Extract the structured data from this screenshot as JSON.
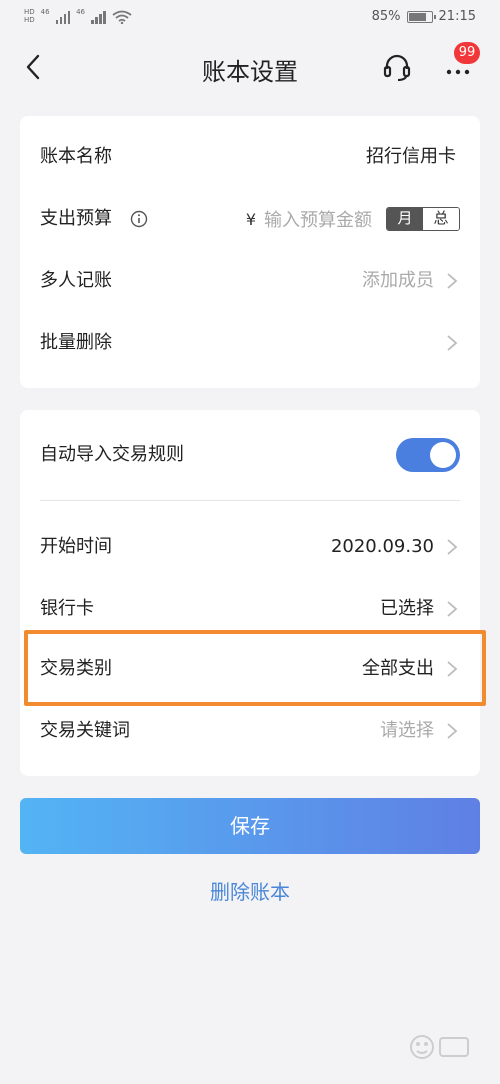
{
  "status_bar": {
    "signal1_label": "46",
    "signal2_label": "46",
    "battery_percent": "85%",
    "battery_level": 0.85,
    "time": "21:15"
  },
  "header": {
    "title": "账本设置",
    "badge_count": "99",
    "icons": [
      "back-icon",
      "headset-icon",
      "more-icon"
    ]
  },
  "settings_card": {
    "ledger_name": {
      "label": "账本名称",
      "value": "招行信用卡"
    },
    "budget": {
      "label": "支出预算",
      "currency": "¥",
      "placeholder": "输入预算金额",
      "segments": [
        "月",
        "总"
      ],
      "selected": "月"
    },
    "members": {
      "label": "多人记账",
      "value": "添加成员"
    },
    "batch_delete": {
      "label": "批量删除"
    }
  },
  "import_card": {
    "auto_import": {
      "label": "自动导入交易规则",
      "enabled": true
    },
    "start_time": {
      "label": "开始时间",
      "value": "2020.09.30"
    },
    "bank_card": {
      "label": "银行卡",
      "value": "已选择"
    },
    "category": {
      "label": "交易类别",
      "value": "全部支出"
    },
    "keyword": {
      "label": "交易关键词",
      "value": "请选择"
    }
  },
  "actions": {
    "save_label": "保存",
    "delete_label": "删除账本"
  },
  "colors": {
    "accent": "#4a7fe0",
    "highlight": "#f28a2e",
    "badge": "#f2373a",
    "link": "#4a87d8"
  }
}
